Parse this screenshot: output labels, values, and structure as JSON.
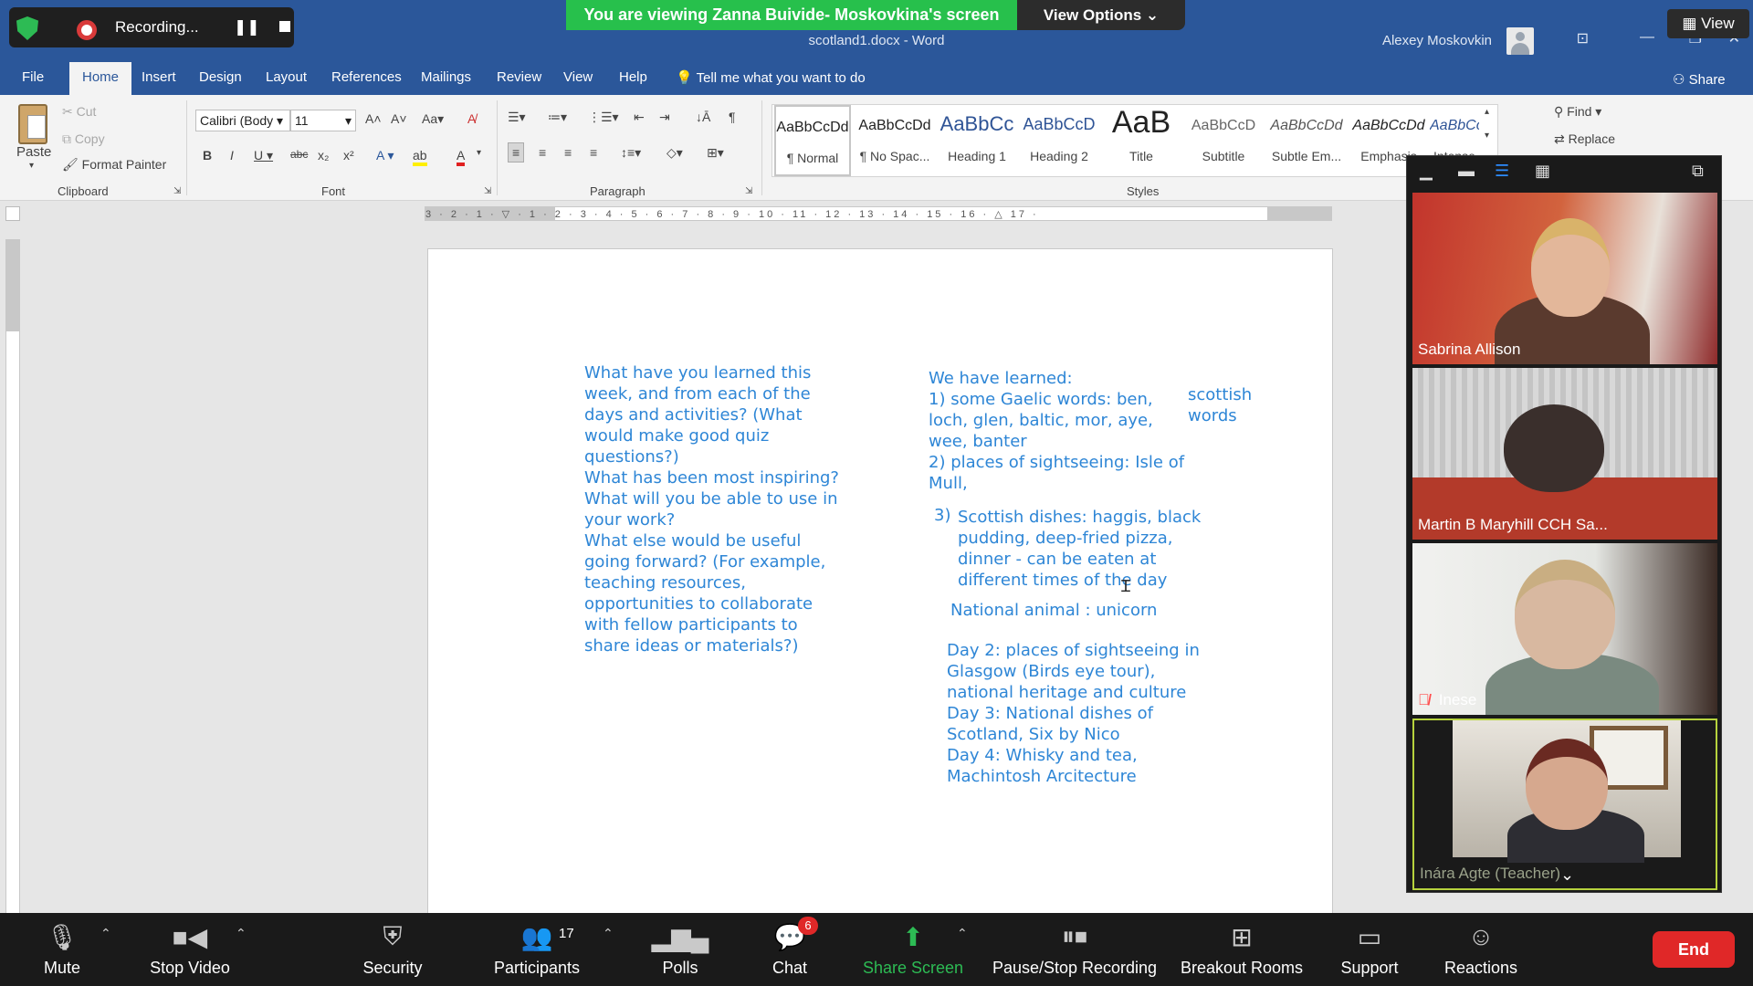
{
  "word": {
    "doc_title": "scotland1.docx  -  Word",
    "user_name": "Alexey Moskovkin",
    "tabs": [
      "File",
      "Home",
      "Insert",
      "Design",
      "Layout",
      "References",
      "Mailings",
      "Review",
      "View",
      "Help"
    ],
    "tell_me": "Tell me what you want to do",
    "share": "Share",
    "clipboard": {
      "paste": "Paste",
      "cut": "Cut",
      "copy": "Copy",
      "format_painter": "Format Painter",
      "label": "Clipboard"
    },
    "font": {
      "family": "Calibri (Body",
      "size": "11",
      "label": "Font"
    },
    "paragraph": {
      "label": "Paragraph"
    },
    "styles": {
      "label": "Styles",
      "items": [
        {
          "preview": "AaBbCcDd",
          "name": "¶ Normal"
        },
        {
          "preview": "AaBbCcDd",
          "name": "¶ No Spac..."
        },
        {
          "preview": "AaBbCc",
          "name": "Heading 1"
        },
        {
          "preview": "AaBbCcD",
          "name": "Heading 2"
        },
        {
          "preview": "AaB",
          "name": "Title"
        },
        {
          "preview": "AaBbCcD",
          "name": "Subtitle"
        },
        {
          "preview": "AaBbCcDd",
          "name": "Subtle Em..."
        },
        {
          "preview": "AaBbCcDd",
          "name": "Emphasis"
        },
        {
          "preview": "AaBbCcDd",
          "name": "Intense E..."
        }
      ]
    },
    "editing": {
      "find": "Find",
      "replace": "Replace"
    },
    "ruler_ticks": "3 · 2 · 1 · ▽ · 1 · 2 · 3 · 4 · 5 · 6 · 7 · 8 · 9 · 10 · 11 · 12 · 13 · 14 · 15 · 16 · △ 17 ·"
  },
  "document": {
    "questions": "What have you learned this\nweek, and from each of the\ndays and activities? (What\nwould make good quiz\nquestions?)\nWhat has been most inspiring?\nWhat will you be able to use in\nyour work?\nWhat else would be useful\ngoing forward? (For example,\nteaching resources,\nopportunities to collaborate\nwith fellow participants to\nshare ideas or materials?)",
    "learned_1": "We have learned:\n1) some Gaelic words: ben,\nloch, glen, baltic, mor, aye,\nwee, banter\n2) places of sightseeing: Isle of\nMull,",
    "side_note": "scottish\nwords",
    "item3_num": "3)",
    "item3_text": "Scottish dishes: haggis, black\npudding, deep-fried pizza,\ndinner - can be eaten at\ndifferent times of the day",
    "national_animal": "National animal : unicorn",
    "days": "Day 2: places of sightseeing in\nGlasgow (Birds eye tour),\nnational heritage and culture\n Day 3: National dishes of\nScotland, Six by Nico\nDay 4: Whisky and tea,\nMachintosh Arcitecture"
  },
  "zoom": {
    "recording": "Recording...",
    "share_banner": "You are viewing Zanna Buivide- Moskovkina's screen",
    "view_options": "View Options",
    "view": "View",
    "participants": [
      {
        "name": "Sabrina Allison"
      },
      {
        "name": "Martin B Maryhill CCH Sa..."
      },
      {
        "name": "Inese"
      },
      {
        "name": "Inára Agte (Teacher)"
      }
    ],
    "toolbar": {
      "mute": "Mute",
      "stop_video": "Stop Video",
      "security": "Security",
      "participants": "Participants",
      "participants_count": "17",
      "polls": "Polls",
      "chat": "Chat",
      "chat_badge": "6",
      "share_screen": "Share Screen",
      "pause_stop": "Pause/Stop Recording",
      "breakout": "Breakout Rooms",
      "support": "Support",
      "reactions": "Reactions",
      "end": "End"
    }
  }
}
